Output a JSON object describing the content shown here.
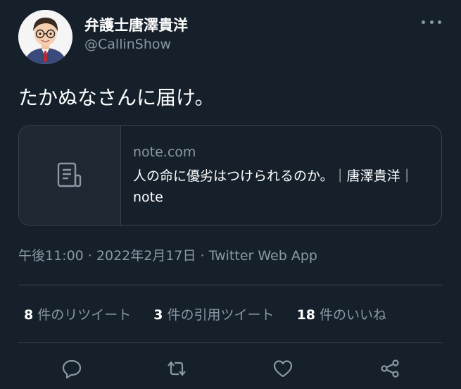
{
  "author": {
    "display_name": "弁護士唐澤貴洋",
    "handle": "@CallinShow",
    "avatar_icon": "avatar-portrait-icon"
  },
  "more_icon": "more-options-icon",
  "tweet": {
    "text": "たかぬなさんに届け。"
  },
  "link_card": {
    "thumbnail_icon": "document-icon",
    "domain": "note.com",
    "title": "人の命に優劣はつけられるのか。｜唐澤貴洋｜note"
  },
  "meta": {
    "time": "午後11:00",
    "date": "2022年2月17日",
    "source": "Twitter Web App",
    "separator": " · "
  },
  "stats": {
    "retweets_count": "8",
    "retweets_label": " 件のリツイート",
    "quotes_count": "3",
    "quotes_label": " 件の引用ツイート",
    "likes_count": "18",
    "likes_label": " 件のいいね"
  },
  "actions": {
    "reply_icon": "reply-icon",
    "retweet_icon": "retweet-icon",
    "like_icon": "like-icon",
    "share_icon": "share-icon"
  },
  "colors": {
    "background": "#15202b",
    "primary_text": "#ffffff",
    "secondary_text": "#8b98a5",
    "border": "#38444d"
  }
}
